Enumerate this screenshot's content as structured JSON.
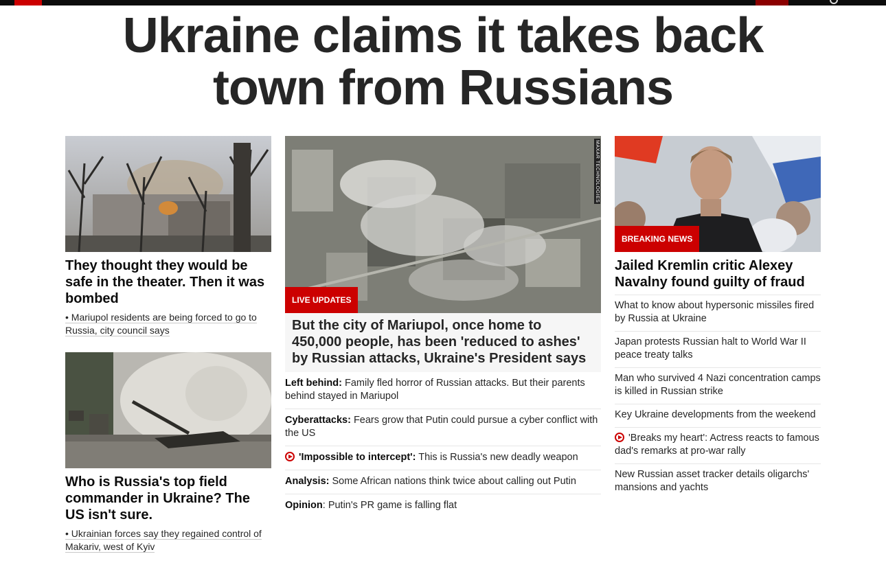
{
  "headline": "Ukraine claims it takes back town from Russians",
  "left": {
    "story1": {
      "title": "They thought they would be safe in the theater. Then it was bombed",
      "sub": "• Mariupol residents are being forced to go to Russia, city council says"
    },
    "story2": {
      "title": "Who is Russia's top field commander in Ukraine? The US isn't sure.",
      "sub": "• Ukrainian forces say they regained control of Makariv, west of Kyiv"
    }
  },
  "middle": {
    "badge": "LIVE UPDATES",
    "image_credit": "MAXAR TECHNOLOGIES",
    "title": "But the city of Mariupol, once home to 450,000 people, has been 'reduced to ashes' by Russian attacks, Ukraine's President says",
    "items": [
      {
        "bold": "Left behind:",
        "text": " Family fled horror of Russian attacks. But their parents behind stayed in Mariupol"
      },
      {
        "bold": "Cyberattacks:",
        "text": " Fears grow that Putin could pursue a cyber conflict with the US"
      },
      {
        "bold": "'Impossible to intercept':",
        "text": " This is Russia's new deadly weapon",
        "icon": "play-icon"
      },
      {
        "bold": "Analysis:",
        "text": " Some African nations think twice about calling out Putin"
      },
      {
        "bold": "Opinion",
        "text": ": Putin's PR game is falling flat"
      }
    ]
  },
  "right": {
    "badge": "BREAKING NEWS",
    "title": "Jailed Kremlin critic Alexey Navalny found guilty of fraud",
    "items": [
      {
        "text": "What to know about hypersonic missiles fired by Russia at Ukraine"
      },
      {
        "text": "Japan protests Russian halt to World War II peace treaty talks"
      },
      {
        "text": "Man who survived 4 Nazi concentration camps is killed in Russian strike"
      },
      {
        "text": "Key Ukraine developments from the weekend"
      },
      {
        "text": "'Breaks my heart': Actress reacts to famous dad's remarks at pro-war rally",
        "icon": "play-icon"
      },
      {
        "text": "New Russian asset tracker details oligarchs' mansions and yachts"
      }
    ]
  },
  "colors": {
    "accent": "#cc0000",
    "text": "#262626"
  }
}
